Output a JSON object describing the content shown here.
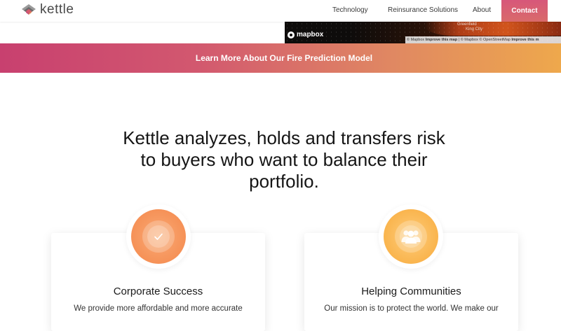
{
  "header": {
    "logo_text": "kettle",
    "nav": {
      "technology": "Technology",
      "reinsurance": "Reinsurance Solutions",
      "about": "About",
      "contact": "Contact"
    }
  },
  "map": {
    "places": [
      "Greenfield",
      "King City"
    ],
    "provider_logo": "mapbox",
    "attribution": [
      "© Mapbox",
      "Improve this map",
      "| © Mapbox © OpenStreetMap",
      "Improve this m"
    ]
  },
  "banner": {
    "label": "Learn More About Our Fire Prediction Model"
  },
  "main": {
    "headline": "Kettle analyzes, holds and transfers risk to buyers who want to balance their portfolio."
  },
  "cards": [
    {
      "title": "Corporate Success",
      "desc": "We provide more affordable and more accurate",
      "icon": "check-icon"
    },
    {
      "title": "Helping Communities",
      "desc": "Our mission is to protect the world. We make our",
      "icon": "people-icon"
    }
  ],
  "colors": {
    "contact_bg": "#d7577a",
    "banner_start": "#c8406f",
    "banner_end": "#eea84c",
    "icon_orange": "#f4874a",
    "icon_yellow": "#f8aa3a"
  }
}
